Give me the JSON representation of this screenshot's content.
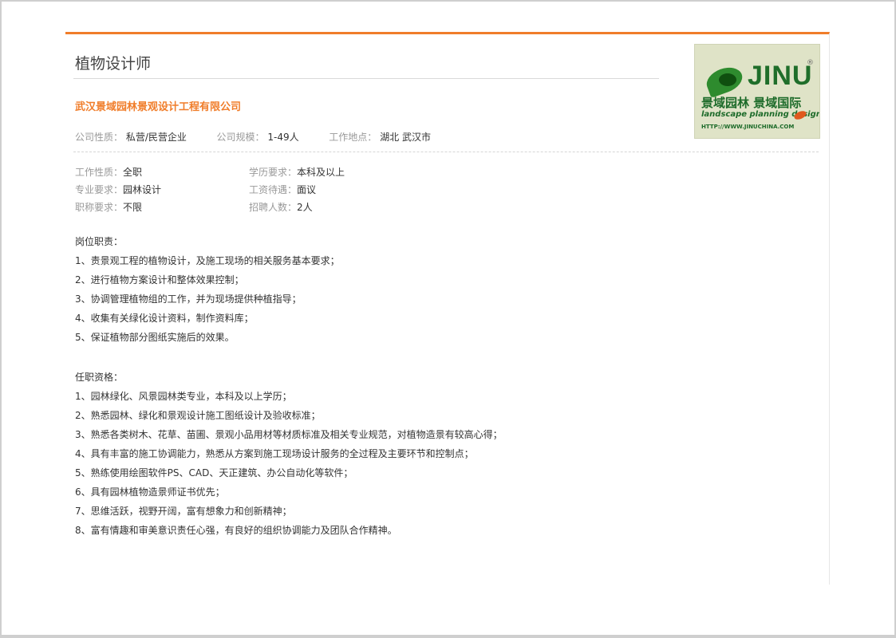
{
  "job": {
    "title": "植物设计师",
    "company": "武汉景域园林景观设计工程有限公司"
  },
  "company_meta": {
    "nature_label": "公司性质：",
    "nature_value": "私营/民营企业",
    "size_label": "公司规模：",
    "size_value": "1-49人",
    "location_label": "工作地点：",
    "location_value": "湖北 武汉市"
  },
  "details": [
    {
      "label1": "工作性质：",
      "value1": "全职",
      "label2": "学历要求：",
      "value2": "本科及以上"
    },
    {
      "label1": "专业要求：",
      "value1": "园林设计",
      "label2": "工资待遇：",
      "value2": "面议"
    },
    {
      "label1": "职称要求：",
      "value1": "不限",
      "label2": "招聘人数：",
      "value2": "2人"
    }
  ],
  "responsibilities": {
    "heading": "岗位职责：",
    "items": [
      "1、责景观工程的植物设计，及施工现场的相关服务基本要求；",
      "2、进行植物方案设计和整体效果控制；",
      "3、协调管理植物组的工作，并为现场提供种植指导；",
      "4、收集有关绿化设计资料，制作资料库；",
      "5、保证植物部分图纸实施后的效果。"
    ]
  },
  "qualifications": {
    "heading": "任职资格：",
    "items": [
      "1、园林绿化、风景园林类专业，本科及以上学历；",
      "2、熟悉园林、绿化和景观设计施工图纸设计及验收标准；",
      "3、熟悉各类树木、花草、苗圃、景观小品用材等材质标准及相关专业规范，对植物造景有较高心得；",
      "4、具有丰富的施工协调能力，熟悉从方案到施工现场设计服务的全过程及主要环节和控制点；",
      "5、熟练使用绘图软件PS、CAD、天正建筑、办公自动化等软件；",
      "6、具有园林植物造景师证书优先；",
      "7、思维活跃，视野开阔，富有想象力和创新精神；",
      "8、富有情趣和审美意识责任心强，有良好的组织协调能力及团队合作精神。"
    ]
  },
  "logo": {
    "brand": "JINU",
    "registered": "®",
    "cn_name": "景域园林 景域国际",
    "en_tagline": "landscape planning design",
    "url": "HTTP://WWW.JINUCHINA.COM"
  },
  "colors": {
    "accent": "#f07d2a",
    "logo_green": "#1d6b2a",
    "label_gray": "#999999"
  }
}
